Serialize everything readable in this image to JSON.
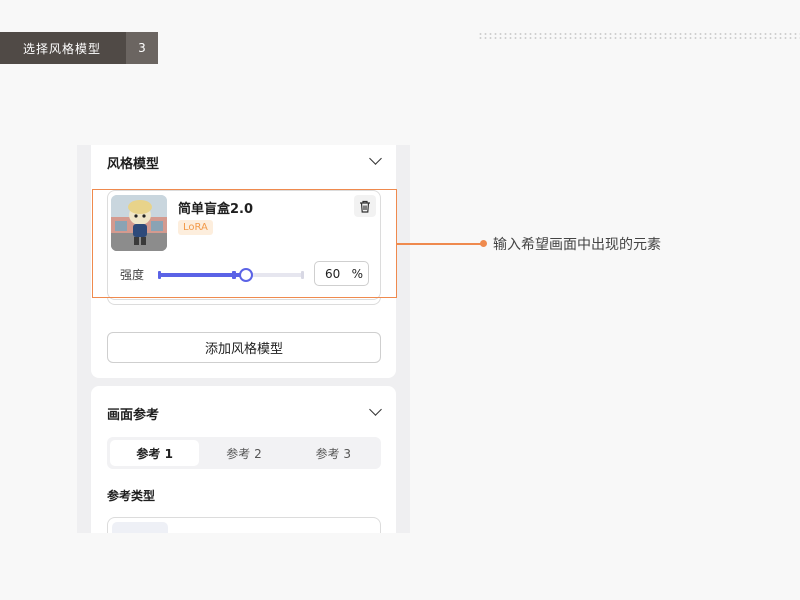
{
  "step": {
    "title": "选择风格模型",
    "number": "3"
  },
  "style_model_section": {
    "title": "风格模型",
    "model": {
      "name": "简单盲盒2.0",
      "tag": "LoRA",
      "strength_label": "强度",
      "strength_value": "60",
      "strength_unit": "%",
      "strength_fraction": 0.6
    },
    "add_button_label": "添加风格模型"
  },
  "reference_section": {
    "title": "画面参考",
    "tabs": [
      {
        "label": "参考 1",
        "active": true
      },
      {
        "label": "参考 2",
        "active": false
      },
      {
        "label": "参考 3",
        "active": false
      }
    ],
    "ref_type_label": "参考类型"
  },
  "callout": {
    "text": "输入希望画面中出现的元素"
  },
  "colors": {
    "accent": "#5b63e6",
    "highlight": "#ef8a4e",
    "tag_bg": "#fdeedd",
    "tag_text": "#f29a4a",
    "header_bg": "#504a46"
  }
}
